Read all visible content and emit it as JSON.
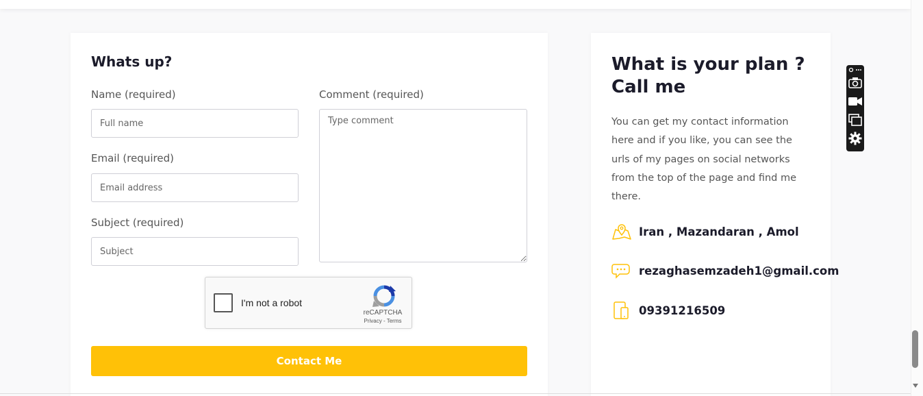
{
  "form": {
    "title": "Whats up?",
    "name_label": "Name (required)",
    "name_placeholder": "Full name",
    "email_label": "Email (required)",
    "email_placeholder": "Email address",
    "subject_label": "Subject (required)",
    "subject_placeholder": "Subject",
    "comment_label": "Comment (required)",
    "comment_placeholder": "Type comment",
    "submit_label": "Contact Me"
  },
  "captcha": {
    "label": "I'm not a robot",
    "brand": "reCAPTCHA",
    "links": "Privacy - Terms"
  },
  "info": {
    "title": "What is your plan ? Call me",
    "description": "You can get my contact information here and if you like, you can see the urls of my pages on social networks from the top of the page and find me there.",
    "address": "Iran , Mazandaran , Amol",
    "email": "rezaghasemzadeh1@gmail.com",
    "phone": "09391216509"
  },
  "colors": {
    "accent": "#ffc107",
    "heading": "#1b1b2a"
  },
  "icons": {
    "address": "map-icon",
    "email": "chat-bubble-icon",
    "phone": "devices-icon"
  }
}
